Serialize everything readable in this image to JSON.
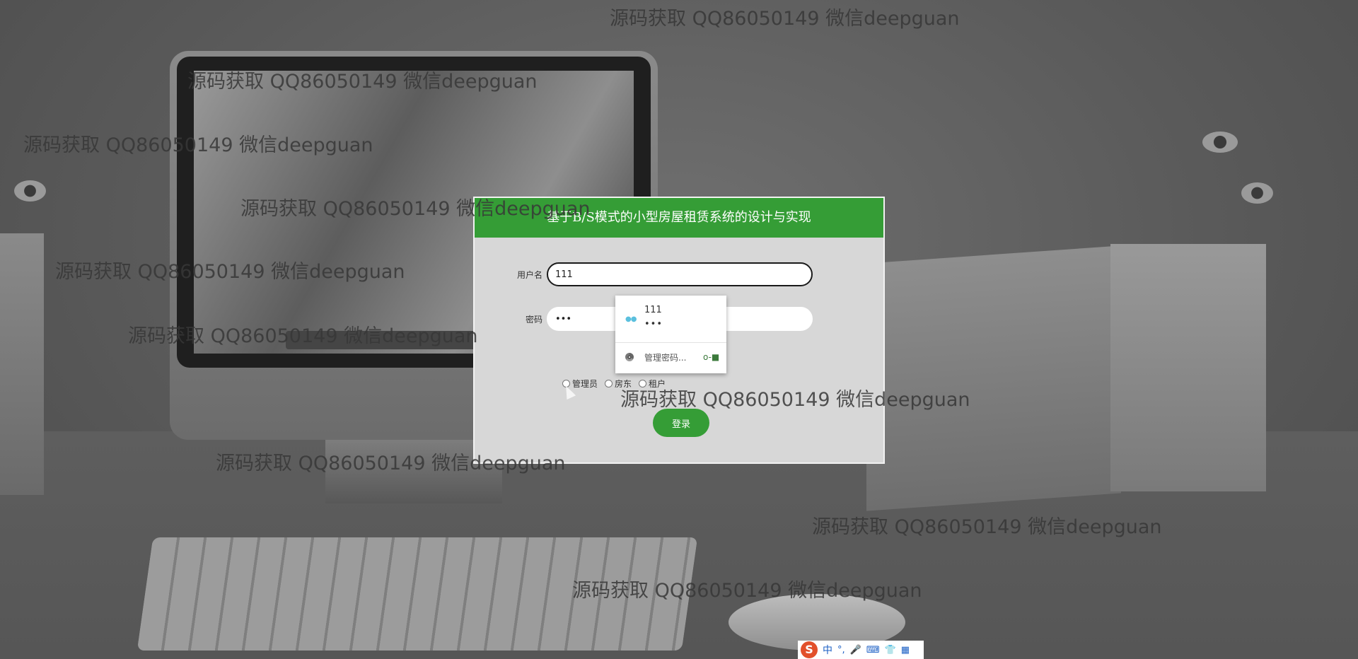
{
  "login": {
    "title": "基于B/S模式的小型房屋租赁系统的设计与实现",
    "username_label": "用户名",
    "username_value": "111",
    "password_label": "密码",
    "password_value": "•••",
    "roles": [
      "管理员",
      "房东",
      "租户"
    ],
    "submit_label": "登录"
  },
  "autofill": {
    "saved_username": "111",
    "saved_password": "•••",
    "manage_label": "管理密码..."
  },
  "watermark_text": "源码获取 QQ86050149 微信deepguan",
  "ime": {
    "logo": "S",
    "mode": "中",
    "punct": "°,",
    "mic": "🎤",
    "keyboard": "⌨",
    "skin": "👕",
    "apps": "▦"
  }
}
